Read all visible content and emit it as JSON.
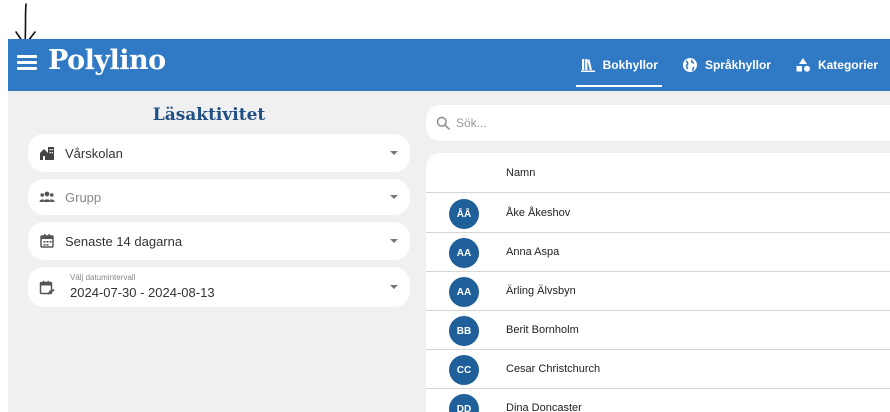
{
  "app": {
    "logo": "Polylino"
  },
  "nav": [
    {
      "label": "Bokhyllor",
      "icon": "bookshelf-icon",
      "active": true
    },
    {
      "label": "Språkhyllor",
      "icon": "globe-icon",
      "active": false
    },
    {
      "label": "Kategorier",
      "icon": "categories-icon",
      "active": false
    }
  ],
  "sidebar": {
    "title": "Läsaktivitet",
    "school": {
      "value": "Vårskolan",
      "icon": "school-building-icon"
    },
    "group": {
      "placeholder": "Grupp",
      "icon": "group-icon"
    },
    "period": {
      "value": "Senaste 14 dagarna",
      "icon": "calendar-icon"
    },
    "date_range": {
      "label": "Välj datumintervall",
      "value": "2024-07-30 - 2024-08-13",
      "icon": "calendar-edit-icon"
    }
  },
  "search": {
    "placeholder": "Sök..."
  },
  "table": {
    "header_name": "Namn",
    "rows": [
      {
        "initials": "ÅÅ",
        "name": "Åke Åkeshov"
      },
      {
        "initials": "AA",
        "name": "Anna Aspa"
      },
      {
        "initials": "AA",
        "name": "Ärling Älvsbyn"
      },
      {
        "initials": "BB",
        "name": "Berit Bornholm"
      },
      {
        "initials": "CC",
        "name": "Cesar Christchurch"
      },
      {
        "initials": "DD",
        "name": "Dina Doncaster"
      }
    ]
  },
  "colors": {
    "topbar": "#2f79c5",
    "avatar": "#1f5f9a",
    "title": "#1f4f84",
    "background": "#f0f0f0"
  }
}
